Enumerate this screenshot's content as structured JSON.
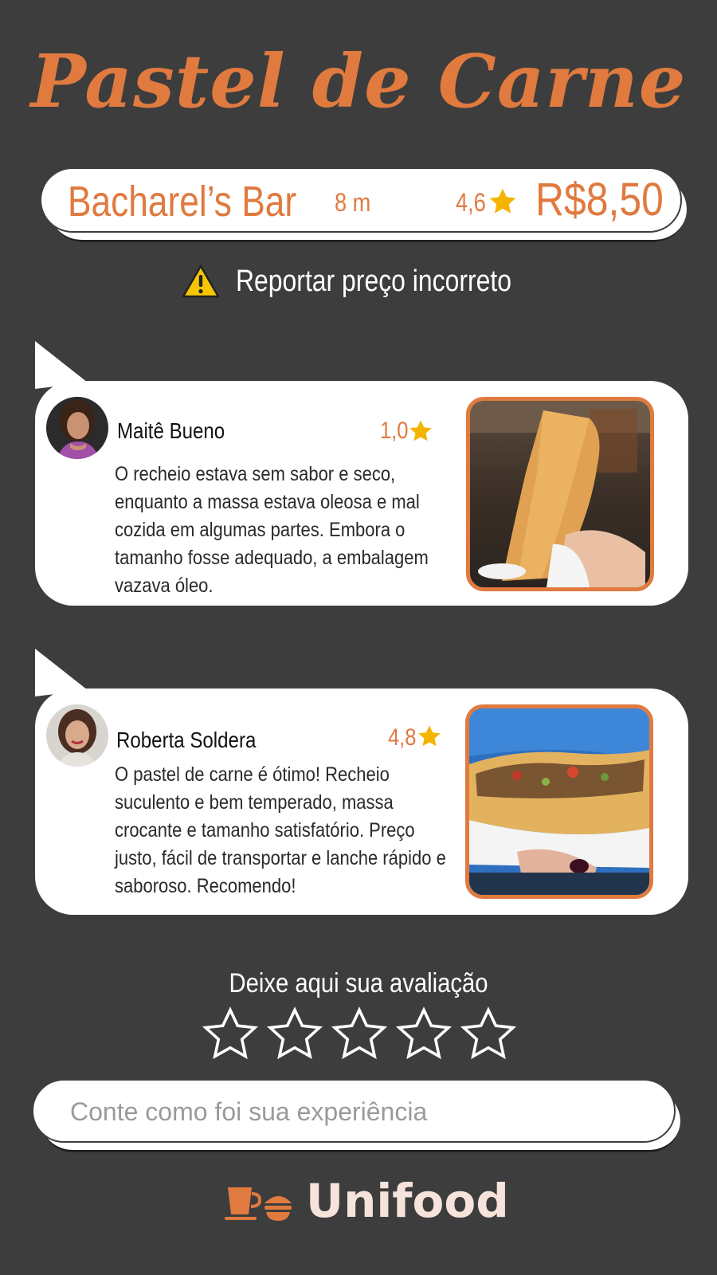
{
  "title": "Pastel de Carne",
  "shop": {
    "name": "Bacharel’s Bar",
    "distance": "8 m",
    "rating": "4,6",
    "price": "R$8,50"
  },
  "report": {
    "label": "Reportar preço incorreto",
    "icon": "warning-icon"
  },
  "reviews": [
    {
      "name": "Maitê Bueno",
      "rating": "1,0",
      "text": "O recheio estava sem sabor e seco, enquanto a massa estava oleosa e mal cozida em algumas partes. Embora o tamanho fosse adequado, a embalagem vazava óleo.",
      "avatar": "avatar-photo",
      "photo": "pastel-photo"
    },
    {
      "name": "Roberta Soldera",
      "rating": "4,8",
      "text": "O pastel de carne é ótimo! Recheio suculento e bem temperado, massa crocante e tamanho satisfatório. Preço justo, fácil de transportar e lanche rápido e saboroso. Recomendo!",
      "avatar": "avatar-photo",
      "photo": "pastel-photo"
    }
  ],
  "leave_review": {
    "title": "Deixe aqui sua avaliação",
    "stars": 5,
    "selected": 0,
    "placeholder": "Conte como foi sua experiência",
    "value": ""
  },
  "brand": {
    "name": "Unifood"
  },
  "colors": {
    "background": "#3d3d3d",
    "accent": "#e07a3f",
    "star": "#f4b400",
    "card": "#ffffff",
    "brand_text": "#f6e4dc"
  }
}
